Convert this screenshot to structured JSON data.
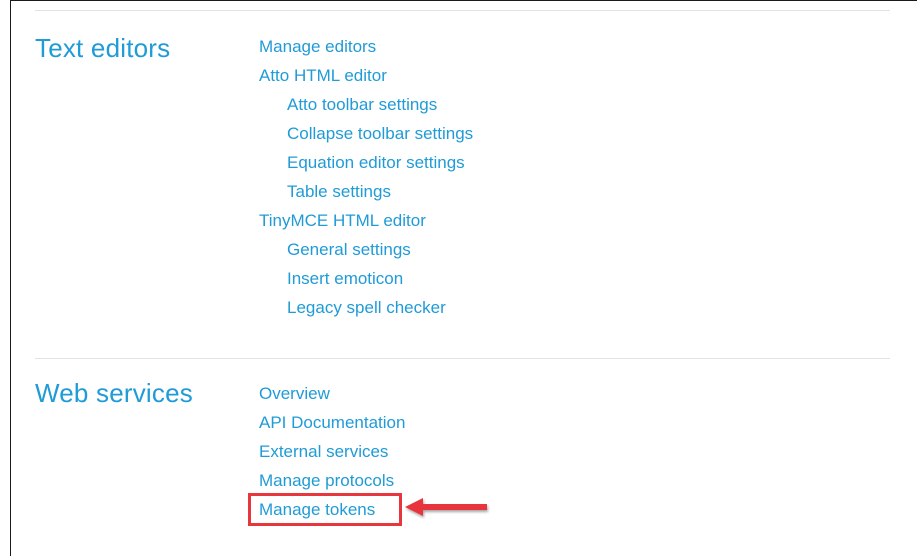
{
  "colors": {
    "link": "#1f9bd7",
    "heading": "#1f9bd7",
    "highlight": "#e8363d",
    "divider": "#e3e3e3"
  },
  "sections": {
    "text_editors": {
      "title": "Text editors",
      "links": [
        "Manage editors",
        "Atto HTML editor",
        "Atto toolbar settings",
        "Collapse toolbar settings",
        "Equation editor settings",
        "Table settings",
        "TinyMCE HTML editor",
        "General settings",
        "Insert emoticon",
        "Legacy spell checker"
      ]
    },
    "web_services": {
      "title": "Web services",
      "links": [
        "Overview",
        "API Documentation",
        "External services",
        "Manage protocols",
        "Manage tokens"
      ]
    }
  },
  "annotation": {
    "highlighted_item": "Manage tokens",
    "arrow_icon": "red-arrow-left-icon"
  }
}
